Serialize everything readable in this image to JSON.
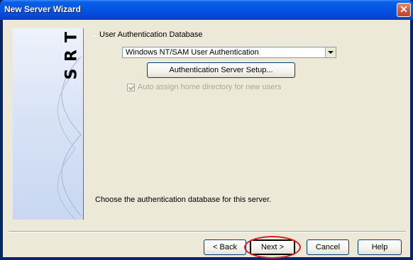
{
  "window": {
    "title": "New Server Wizard",
    "close_icon": "close-icon",
    "title_gradient": "#0554E3",
    "close_color": "#D45A3A"
  },
  "sidebar": {
    "letters": [
      "S",
      "R",
      "T"
    ]
  },
  "group": {
    "label": "User Authentication Database",
    "auth_db_value": "Windows NT/SAM User Authentication",
    "auth_setup_button": "Authentication Server Setup...",
    "auto_assign_label": "Auto assign home directory for new users",
    "auto_assign_checked": true,
    "auto_assign_disabled": true
  },
  "hint": "Choose the authentication database for this server.",
  "buttons": {
    "back": "< Back",
    "next": "Next >",
    "cancel": "Cancel",
    "help": "Help"
  },
  "annotation": {
    "highlight_color": "#D02525"
  }
}
